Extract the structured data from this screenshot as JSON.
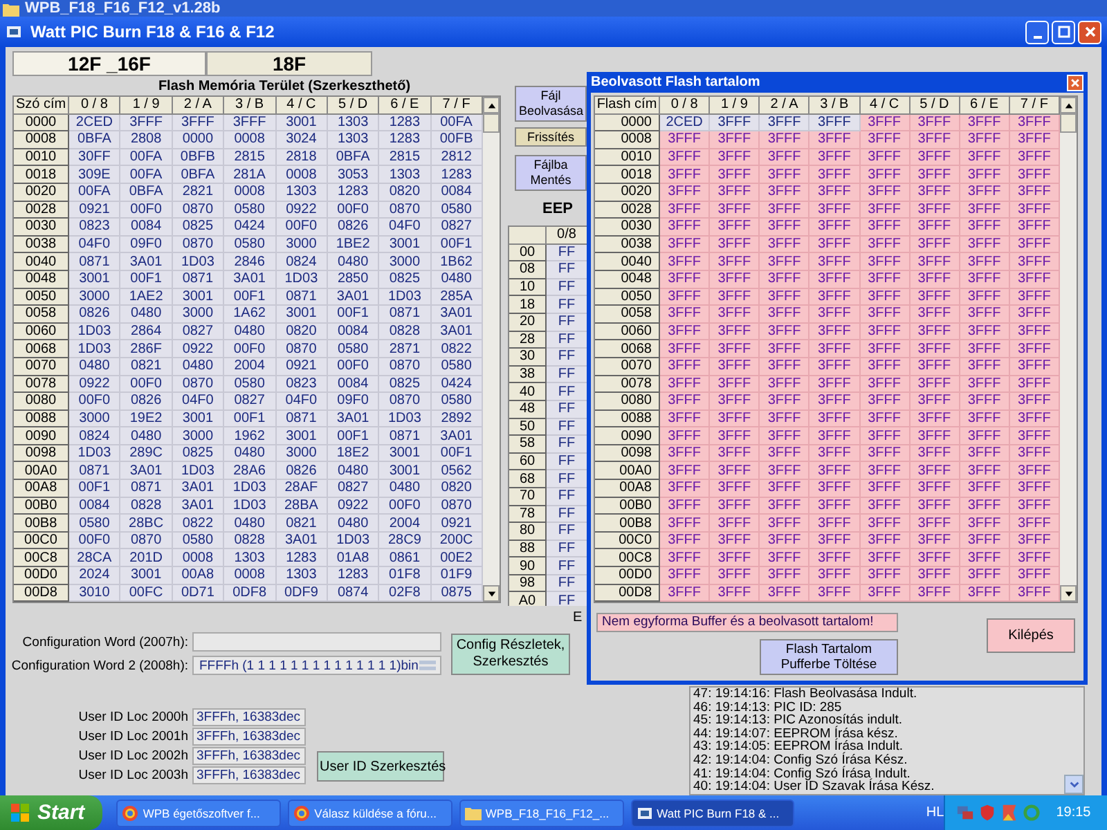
{
  "background_window": {
    "title": "WPB_F18_F16_F12_v1.28b"
  },
  "window": {
    "title": "Watt PIC Burn F18 & F16 & F12"
  },
  "tabs": [
    {
      "label": "12F _16F",
      "selected": true
    },
    {
      "label": "18F",
      "selected": false
    }
  ],
  "flash_table": {
    "title": "Flash Memória Terület (Szerkeszthető)",
    "columns": [
      "Szó cím",
      "0 / 8",
      "1 / 9",
      "2 / A",
      "3 / B",
      "4 / C",
      "5 / D",
      "6 / E",
      "7 / F"
    ],
    "rows": [
      {
        "address": "0000",
        "values": [
          "2CED",
          "3FFF",
          "3FFF",
          "3FFF",
          "3001",
          "1303",
          "1283",
          "00FA"
        ]
      },
      {
        "address": "0008",
        "values": [
          "0BFA",
          "2808",
          "0000",
          "0008",
          "3024",
          "1303",
          "1283",
          "00FB"
        ]
      },
      {
        "address": "0010",
        "values": [
          "30FF",
          "00FA",
          "0BFB",
          "2815",
          "2818",
          "0BFA",
          "2815",
          "2812"
        ]
      },
      {
        "address": "0018",
        "values": [
          "309E",
          "00FA",
          "0BFA",
          "281A",
          "0008",
          "3053",
          "1303",
          "1283"
        ]
      },
      {
        "address": "0020",
        "values": [
          "00FA",
          "0BFA",
          "2821",
          "0008",
          "1303",
          "1283",
          "0820",
          "0084"
        ]
      },
      {
        "address": "0028",
        "values": [
          "0921",
          "00F0",
          "0870",
          "0580",
          "0922",
          "00F0",
          "0870",
          "0580"
        ]
      },
      {
        "address": "0030",
        "values": [
          "0823",
          "0084",
          "0825",
          "0424",
          "00F0",
          "0826",
          "04F0",
          "0827"
        ]
      },
      {
        "address": "0038",
        "values": [
          "04F0",
          "09F0",
          "0870",
          "0580",
          "3000",
          "1BE2",
          "3001",
          "00F1"
        ]
      },
      {
        "address": "0040",
        "values": [
          "0871",
          "3A01",
          "1D03",
          "2846",
          "0824",
          "0480",
          "3000",
          "1B62"
        ]
      },
      {
        "address": "0048",
        "values": [
          "3001",
          "00F1",
          "0871",
          "3A01",
          "1D03",
          "2850",
          "0825",
          "0480"
        ]
      },
      {
        "address": "0050",
        "values": [
          "3000",
          "1AE2",
          "3001",
          "00F1",
          "0871",
          "3A01",
          "1D03",
          "285A"
        ]
      },
      {
        "address": "0058",
        "values": [
          "0826",
          "0480",
          "3000",
          "1A62",
          "3001",
          "00F1",
          "0871",
          "3A01"
        ]
      },
      {
        "address": "0060",
        "values": [
          "1D03",
          "2864",
          "0827",
          "0480",
          "0820",
          "0084",
          "0828",
          "3A01"
        ]
      },
      {
        "address": "0068",
        "values": [
          "1D03",
          "286F",
          "0922",
          "00F0",
          "0870",
          "0580",
          "2871",
          "0822"
        ]
      },
      {
        "address": "0070",
        "values": [
          "0480",
          "0821",
          "0480",
          "2004",
          "0921",
          "00F0",
          "0870",
          "0580"
        ]
      },
      {
        "address": "0078",
        "values": [
          "0922",
          "00F0",
          "0870",
          "0580",
          "0823",
          "0084",
          "0825",
          "0424"
        ]
      },
      {
        "address": "0080",
        "values": [
          "00F0",
          "0826",
          "04F0",
          "0827",
          "04F0",
          "09F0",
          "0870",
          "0580"
        ]
      },
      {
        "address": "0088",
        "values": [
          "3000",
          "19E2",
          "3001",
          "00F1",
          "0871",
          "3A01",
          "1D03",
          "2892"
        ]
      },
      {
        "address": "0090",
        "values": [
          "0824",
          "0480",
          "3000",
          "1962",
          "3001",
          "00F1",
          "0871",
          "3A01"
        ]
      },
      {
        "address": "0098",
        "values": [
          "1D03",
          "289C",
          "0825",
          "0480",
          "3000",
          "18E2",
          "3001",
          "00F1"
        ]
      },
      {
        "address": "00A0",
        "values": [
          "0871",
          "3A01",
          "1D03",
          "28A6",
          "0826",
          "0480",
          "3001",
          "0562"
        ]
      },
      {
        "address": "00A8",
        "values": [
          "00F1",
          "0871",
          "3A01",
          "1D03",
          "28AF",
          "0827",
          "0480",
          "0820"
        ]
      },
      {
        "address": "00B0",
        "values": [
          "0084",
          "0828",
          "3A01",
          "1D03",
          "28BA",
          "0922",
          "00F0",
          "0870"
        ]
      },
      {
        "address": "00B8",
        "values": [
          "0580",
          "28BC",
          "0822",
          "0480",
          "0821",
          "0480",
          "2004",
          "0921"
        ]
      },
      {
        "address": "00C0",
        "values": [
          "00F0",
          "0870",
          "0580",
          "0828",
          "3A01",
          "1D03",
          "28C9",
          "200C"
        ]
      },
      {
        "address": "00C8",
        "values": [
          "28CA",
          "201D",
          "0008",
          "1303",
          "1283",
          "01A8",
          "0861",
          "00E2"
        ]
      },
      {
        "address": "00D0",
        "values": [
          "2024",
          "3001",
          "00A8",
          "0008",
          "1303",
          "1283",
          "01F8",
          "01F9"
        ]
      },
      {
        "address": "00D8",
        "values": [
          "3010",
          "00FC",
          "0D71",
          "0DF8",
          "0DF9",
          "0874",
          "02F8",
          "0875"
        ]
      }
    ]
  },
  "side_buttons": [
    {
      "label": "Fájl Beolvasása",
      "kind": "file"
    },
    {
      "label": "Frissítés",
      "kind": "refresh"
    },
    {
      "label": "Fájlba Mentés",
      "kind": "file"
    }
  ],
  "eeprom": {
    "title": "EEP",
    "columns": [
      "0/8"
    ],
    "rows": [
      {
        "address": "00",
        "value": "FF"
      },
      {
        "address": "08",
        "value": "FF"
      },
      {
        "address": "10",
        "value": "FF"
      },
      {
        "address": "18",
        "value": "FF"
      },
      {
        "address": "20",
        "value": "FF"
      },
      {
        "address": "28",
        "value": "FF"
      },
      {
        "address": "30",
        "value": "FF"
      },
      {
        "address": "38",
        "value": "FF"
      },
      {
        "address": "40",
        "value": "FF"
      },
      {
        "address": "48",
        "value": "FF"
      },
      {
        "address": "50",
        "value": "FF"
      },
      {
        "address": "58",
        "value": "FF"
      },
      {
        "address": "60",
        "value": "FF"
      },
      {
        "address": "68",
        "value": "FF"
      },
      {
        "address": "70",
        "value": "FF"
      },
      {
        "address": "78",
        "value": "FF"
      },
      {
        "address": "80",
        "value": "FF"
      },
      {
        "address": "88",
        "value": "FF"
      },
      {
        "address": "90",
        "value": "FF"
      },
      {
        "address": "98",
        "value": "FF"
      },
      {
        "address": "A0",
        "value": "FF"
      }
    ]
  },
  "eeprom_label_fragment": "E",
  "config": {
    "words": [
      {
        "label": "Configuration Word (2007h):"
      },
      {
        "label": "Configuration Word 2 (2008h):",
        "value": "FFFFh  (1 1 1 1 1 1 1 1 1 1 1 1 1 1)bin"
      }
    ],
    "button": "Config Részletek, Szerkesztés"
  },
  "user_ids": {
    "items": [
      {
        "label": "User ID Loc 2000h",
        "value": "3FFFh, 16383dec"
      },
      {
        "label": "User ID Loc 2001h",
        "value": "3FFFh, 16383dec"
      },
      {
        "label": "User ID Loc 2002h",
        "value": "3FFFh, 16383dec"
      },
      {
        "label": "User ID Loc 2003h",
        "value": "3FFFh, 16383dec"
      }
    ],
    "button": "User ID Szerkesztés"
  },
  "log": [
    "47:  19:14:16:  Flash Beolvasása Indult.",
    "46:  19:14:13: PIC ID: 285",
    "45:  19:14:13:  PIC Azonosítás indult.",
    "44:  19:14:07:  EEPROM Írása kész.",
    "43:  19:14:05:  EEPROM Írása Indult.",
    "42:  19:14:04:  Config Szó Írása Kész.",
    "41:  19:14:04:  Config Szó Írása Indult.",
    "40:  19:14:04:  User ID Szavak Írása Kész."
  ],
  "read_dialog": {
    "title": "Beolvasott Flash tartalom",
    "columns": [
      "Flash cím",
      "0 / 8",
      "1 / 9",
      "2 / A",
      "3 / B",
      "4 / C",
      "5 / D",
      "6 / E",
      "7 / F"
    ],
    "rows": [
      {
        "address": "0000",
        "values": [
          "2CED",
          "3FFF",
          "3FFF",
          "3FFF",
          "3FFF",
          "3FFF",
          "3FFF",
          "3FFF"
        ],
        "mismatch": [
          false,
          false,
          false,
          false,
          true,
          true,
          true,
          true
        ]
      },
      {
        "address": "0008",
        "values": [
          "3FFF",
          "3FFF",
          "3FFF",
          "3FFF",
          "3FFF",
          "3FFF",
          "3FFF",
          "3FFF"
        ],
        "mismatch": [
          true,
          true,
          true,
          true,
          true,
          true,
          true,
          true
        ]
      },
      {
        "address": "0010",
        "values": [
          "3FFF",
          "3FFF",
          "3FFF",
          "3FFF",
          "3FFF",
          "3FFF",
          "3FFF",
          "3FFF"
        ],
        "mismatch": [
          true,
          true,
          true,
          true,
          true,
          true,
          true,
          true
        ]
      },
      {
        "address": "0018",
        "values": [
          "3FFF",
          "3FFF",
          "3FFF",
          "3FFF",
          "3FFF",
          "3FFF",
          "3FFF",
          "3FFF"
        ],
        "mismatch": [
          true,
          true,
          true,
          true,
          true,
          true,
          true,
          true
        ]
      },
      {
        "address": "0020",
        "values": [
          "3FFF",
          "3FFF",
          "3FFF",
          "3FFF",
          "3FFF",
          "3FFF",
          "3FFF",
          "3FFF"
        ],
        "mismatch": [
          true,
          true,
          true,
          true,
          true,
          true,
          true,
          true
        ]
      },
      {
        "address": "0028",
        "values": [
          "3FFF",
          "3FFF",
          "3FFF",
          "3FFF",
          "3FFF",
          "3FFF",
          "3FFF",
          "3FFF"
        ],
        "mismatch": [
          true,
          true,
          true,
          true,
          true,
          true,
          true,
          true
        ]
      },
      {
        "address": "0030",
        "values": [
          "3FFF",
          "3FFF",
          "3FFF",
          "3FFF",
          "3FFF",
          "3FFF",
          "3FFF",
          "3FFF"
        ],
        "mismatch": [
          true,
          true,
          true,
          true,
          true,
          true,
          true,
          true
        ]
      },
      {
        "address": "0038",
        "values": [
          "3FFF",
          "3FFF",
          "3FFF",
          "3FFF",
          "3FFF",
          "3FFF",
          "3FFF",
          "3FFF"
        ],
        "mismatch": [
          true,
          true,
          true,
          true,
          true,
          true,
          true,
          true
        ]
      },
      {
        "address": "0040",
        "values": [
          "3FFF",
          "3FFF",
          "3FFF",
          "3FFF",
          "3FFF",
          "3FFF",
          "3FFF",
          "3FFF"
        ],
        "mismatch": [
          true,
          true,
          true,
          true,
          true,
          true,
          true,
          true
        ]
      },
      {
        "address": "0048",
        "values": [
          "3FFF",
          "3FFF",
          "3FFF",
          "3FFF",
          "3FFF",
          "3FFF",
          "3FFF",
          "3FFF"
        ],
        "mismatch": [
          true,
          true,
          true,
          true,
          true,
          true,
          true,
          true
        ]
      },
      {
        "address": "0050",
        "values": [
          "3FFF",
          "3FFF",
          "3FFF",
          "3FFF",
          "3FFF",
          "3FFF",
          "3FFF",
          "3FFF"
        ],
        "mismatch": [
          true,
          true,
          true,
          true,
          true,
          true,
          true,
          true
        ]
      },
      {
        "address": "0058",
        "values": [
          "3FFF",
          "3FFF",
          "3FFF",
          "3FFF",
          "3FFF",
          "3FFF",
          "3FFF",
          "3FFF"
        ],
        "mismatch": [
          true,
          true,
          true,
          true,
          true,
          true,
          true,
          true
        ]
      },
      {
        "address": "0060",
        "values": [
          "3FFF",
          "3FFF",
          "3FFF",
          "3FFF",
          "3FFF",
          "3FFF",
          "3FFF",
          "3FFF"
        ],
        "mismatch": [
          true,
          true,
          true,
          true,
          true,
          true,
          true,
          true
        ]
      },
      {
        "address": "0068",
        "values": [
          "3FFF",
          "3FFF",
          "3FFF",
          "3FFF",
          "3FFF",
          "3FFF",
          "3FFF",
          "3FFF"
        ],
        "mismatch": [
          true,
          true,
          true,
          true,
          true,
          true,
          true,
          true
        ]
      },
      {
        "address": "0070",
        "values": [
          "3FFF",
          "3FFF",
          "3FFF",
          "3FFF",
          "3FFF",
          "3FFF",
          "3FFF",
          "3FFF"
        ],
        "mismatch": [
          true,
          true,
          true,
          true,
          true,
          true,
          true,
          true
        ]
      },
      {
        "address": "0078",
        "values": [
          "3FFF",
          "3FFF",
          "3FFF",
          "3FFF",
          "3FFF",
          "3FFF",
          "3FFF",
          "3FFF"
        ],
        "mismatch": [
          true,
          true,
          true,
          true,
          true,
          true,
          true,
          true
        ]
      },
      {
        "address": "0080",
        "values": [
          "3FFF",
          "3FFF",
          "3FFF",
          "3FFF",
          "3FFF",
          "3FFF",
          "3FFF",
          "3FFF"
        ],
        "mismatch": [
          true,
          true,
          true,
          true,
          true,
          true,
          true,
          true
        ]
      },
      {
        "address": "0088",
        "values": [
          "3FFF",
          "3FFF",
          "3FFF",
          "3FFF",
          "3FFF",
          "3FFF",
          "3FFF",
          "3FFF"
        ],
        "mismatch": [
          true,
          true,
          true,
          true,
          true,
          true,
          true,
          true
        ]
      },
      {
        "address": "0090",
        "values": [
          "3FFF",
          "3FFF",
          "3FFF",
          "3FFF",
          "3FFF",
          "3FFF",
          "3FFF",
          "3FFF"
        ],
        "mismatch": [
          true,
          true,
          true,
          true,
          true,
          true,
          true,
          true
        ]
      },
      {
        "address": "0098",
        "values": [
          "3FFF",
          "3FFF",
          "3FFF",
          "3FFF",
          "3FFF",
          "3FFF",
          "3FFF",
          "3FFF"
        ],
        "mismatch": [
          true,
          true,
          true,
          true,
          true,
          true,
          true,
          true
        ]
      },
      {
        "address": "00A0",
        "values": [
          "3FFF",
          "3FFF",
          "3FFF",
          "3FFF",
          "3FFF",
          "3FFF",
          "3FFF",
          "3FFF"
        ],
        "mismatch": [
          true,
          true,
          true,
          true,
          true,
          true,
          true,
          true
        ]
      },
      {
        "address": "00A8",
        "values": [
          "3FFF",
          "3FFF",
          "3FFF",
          "3FFF",
          "3FFF",
          "3FFF",
          "3FFF",
          "3FFF"
        ],
        "mismatch": [
          true,
          true,
          true,
          true,
          true,
          true,
          true,
          true
        ]
      },
      {
        "address": "00B0",
        "values": [
          "3FFF",
          "3FFF",
          "3FFF",
          "3FFF",
          "3FFF",
          "3FFF",
          "3FFF",
          "3FFF"
        ],
        "mismatch": [
          true,
          true,
          true,
          true,
          true,
          true,
          true,
          true
        ]
      },
      {
        "address": "00B8",
        "values": [
          "3FFF",
          "3FFF",
          "3FFF",
          "3FFF",
          "3FFF",
          "3FFF",
          "3FFF",
          "3FFF"
        ],
        "mismatch": [
          true,
          true,
          true,
          true,
          true,
          true,
          true,
          true
        ]
      },
      {
        "address": "00C0",
        "values": [
          "3FFF",
          "3FFF",
          "3FFF",
          "3FFF",
          "3FFF",
          "3FFF",
          "3FFF",
          "3FFF"
        ],
        "mismatch": [
          true,
          true,
          true,
          true,
          true,
          true,
          true,
          true
        ]
      },
      {
        "address": "00C8",
        "values": [
          "3FFF",
          "3FFF",
          "3FFF",
          "3FFF",
          "3FFF",
          "3FFF",
          "3FFF",
          "3FFF"
        ],
        "mismatch": [
          true,
          true,
          true,
          true,
          true,
          true,
          true,
          true
        ]
      },
      {
        "address": "00D0",
        "values": [
          "3FFF",
          "3FFF",
          "3FFF",
          "3FFF",
          "3FFF",
          "3FFF",
          "3FFF",
          "3FFF"
        ],
        "mismatch": [
          true,
          true,
          true,
          true,
          true,
          true,
          true,
          true
        ]
      },
      {
        "address": "00D8",
        "values": [
          "3FFF",
          "3FFF",
          "3FFF",
          "3FFF",
          "3FFF",
          "3FFF",
          "3FFF",
          "3FFF"
        ],
        "mismatch": [
          true,
          true,
          true,
          true,
          true,
          true,
          true,
          true
        ]
      }
    ],
    "message": "Nem egyforma Buffer és a beolvasott tartalom!",
    "load_button": "Flash Tartalom Pufferbe Töltése",
    "exit_button": "Kilépés"
  },
  "taskbar": {
    "start": "Start",
    "items": [
      {
        "label": "WPB égetőszoftver f...",
        "kind": "browser",
        "selected": false
      },
      {
        "label": "Válasz küldése a fóru...",
        "kind": "browser",
        "selected": false
      },
      {
        "label": "WPB_F18_F16_F12_...",
        "kind": "folder",
        "selected": false
      },
      {
        "label": "Watt PIC Burn F18 & ...",
        "kind": "app",
        "selected": true
      }
    ],
    "language": "HL",
    "clock": "19:15"
  }
}
